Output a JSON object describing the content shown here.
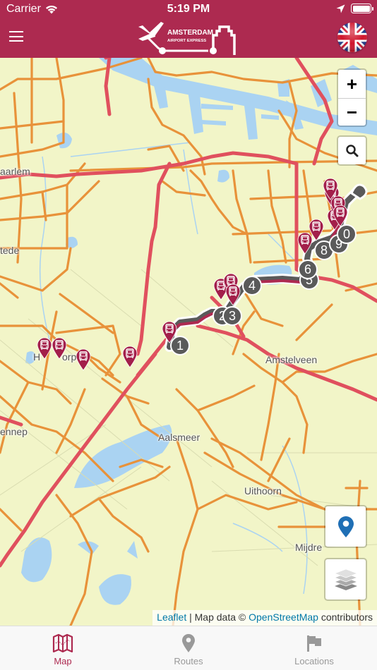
{
  "status_bar": {
    "carrier": "Carrier",
    "time": "5:19 PM",
    "battery_percent": 100
  },
  "header": {
    "logo_line1": "AMSTERDAM",
    "logo_line2": "AIRPORT EXPRESS",
    "menu_icon": "hamburger-icon",
    "language_flag": "uk-flag",
    "brand_color": "#ad2a50"
  },
  "map": {
    "place_labels": [
      {
        "text": "aarlem"
      },
      {
        "text": "tede"
      },
      {
        "text": "H"
      },
      {
        "text": "orp"
      },
      {
        "text": "Amstelveen"
      },
      {
        "text": "ennep"
      },
      {
        "text": "Aalsmeer"
      },
      {
        "text": "Uithoorn"
      },
      {
        "text": "Mijdre"
      }
    ],
    "controls": {
      "zoom_in": "+",
      "zoom_out": "−",
      "search_icon": "search-icon",
      "locate_icon": "location-pin-icon",
      "layers_icon": "layers-icon"
    },
    "route_stops": [
      "1",
      "2",
      "3",
      "4",
      "5",
      "6",
      "8",
      "9",
      "0"
    ],
    "attribution": {
      "leaflet": "Leaflet",
      "separator": " | Map data © ",
      "osm": "OpenStreetMap",
      "suffix": " contributors"
    },
    "colors": {
      "land": "#f2f5c8",
      "water": "#aad3f2",
      "major_road": "#e0505e",
      "secondary_road": "#e8923a",
      "route_active": "#ad2a50",
      "route_inactive": "#5a5a5a",
      "marker": "#a31f4a",
      "link": "#0078a8"
    }
  },
  "tabbar": {
    "tabs": [
      {
        "label": "Map",
        "icon": "map-icon",
        "active": true
      },
      {
        "label": "Routes",
        "icon": "pin-icon",
        "active": false
      },
      {
        "label": "Locations",
        "icon": "flag-icon",
        "active": false
      }
    ]
  }
}
